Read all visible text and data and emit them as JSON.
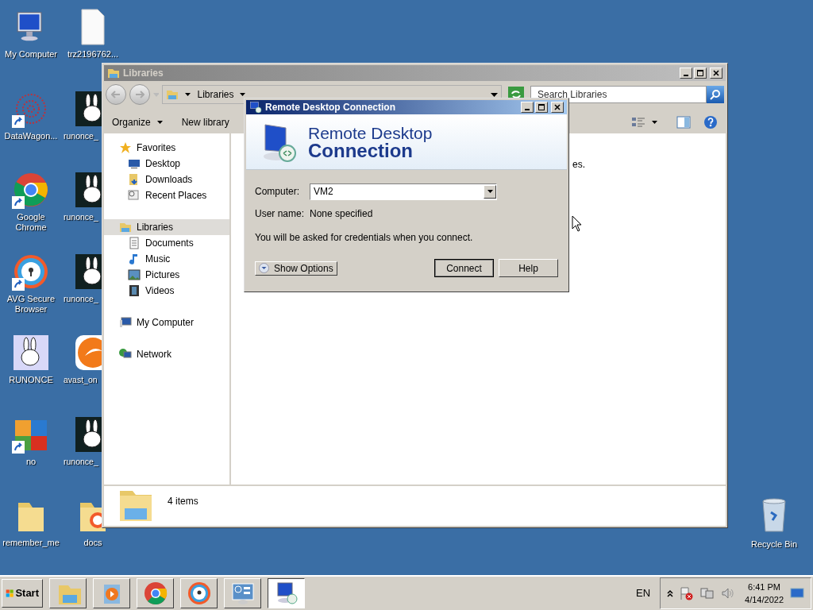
{
  "desktop_icons": [
    {
      "label": "My Computer",
      "kind": "computer",
      "shortcut": false
    },
    {
      "label": "DataWagon...",
      "kind": "network-graphic",
      "shortcut": true
    },
    {
      "label": "Google Chrome",
      "kind": "chrome",
      "shortcut": true
    },
    {
      "label": "AVG Secure Browser",
      "kind": "avg-browser",
      "shortcut": true
    },
    {
      "label": "RUNONCE",
      "kind": "rabbit",
      "shortcut": false
    },
    {
      "label": "no",
      "kind": "avg",
      "shortcut": true
    },
    {
      "label": "remember_me",
      "kind": "folder",
      "shortcut": false
    },
    {
      "label": "trz2196762...",
      "kind": "file",
      "shortcut": false
    },
    {
      "label": "runonce_",
      "kind": "rabbit-thumb",
      "shortcut": false
    },
    {
      "label": "runonce_",
      "kind": "rabbit-thumb",
      "shortcut": false
    },
    {
      "label": "runonce_",
      "kind": "rabbit-thumb",
      "shortcut": false
    },
    {
      "label": "avast_on",
      "kind": "avast",
      "shortcut": false
    },
    {
      "label": "runonce_",
      "kind": "rabbit-thumb",
      "shortcut": false
    },
    {
      "label": "docs",
      "kind": "folder-app",
      "shortcut": false
    }
  ],
  "recycle_bin": {
    "label": "Recycle Bin"
  },
  "libraries_window": {
    "title": "Libraries",
    "active": false,
    "address": "Libraries",
    "search": {
      "placeholder": "Search Libraries"
    },
    "commands": [
      {
        "label": "Organize",
        "menu": true
      },
      {
        "label": "New library",
        "menu": false
      }
    ],
    "nav": [
      {
        "label": "Favorites",
        "kind": "star",
        "selected": false,
        "children": [
          {
            "label": "Desktop",
            "kind": "desktop",
            "selected": false
          },
          {
            "label": "Downloads",
            "kind": "downloads",
            "selected": false
          },
          {
            "label": "Recent Places",
            "kind": "recent",
            "selected": false
          }
        ]
      },
      {
        "label": "Libraries",
        "kind": "library",
        "selected": true,
        "children": [
          {
            "label": "Documents",
            "kind": "documents",
            "selected": false
          },
          {
            "label": "Music",
            "kind": "music",
            "selected": false
          },
          {
            "label": "Pictures",
            "kind": "pictures",
            "selected": false
          },
          {
            "label": "Videos",
            "kind": "videos",
            "selected": false
          }
        ]
      },
      {
        "label": "My Computer",
        "kind": "computer",
        "selected": false
      },
      {
        "label": "Network",
        "kind": "network",
        "selected": false
      }
    ],
    "content_text": "es.",
    "status": "4 items"
  },
  "rdc_dialog": {
    "title": "Remote Desktop Connection",
    "active": true,
    "heading": "Remote Desktop",
    "heading_bold": "Connection",
    "computer": {
      "label": "Computer:",
      "value": "VM2"
    },
    "user": {
      "label": "User name:",
      "value": "None specified"
    },
    "note": "You will be asked for credentials when you connect.",
    "show_options": "Show Options",
    "buttons": [
      {
        "label": "Connect",
        "default": true
      },
      {
        "label": "Help",
        "default": false
      }
    ]
  },
  "taskbar": {
    "start": "Start",
    "apps": [
      {
        "kind": "explorer",
        "active": false
      },
      {
        "kind": "media",
        "active": false
      },
      {
        "kind": "chrome",
        "active": false
      },
      {
        "kind": "avg-browser",
        "active": false
      },
      {
        "kind": "control-panel",
        "active": false
      },
      {
        "kind": "rdc",
        "active": true
      }
    ],
    "language": "EN",
    "time": "6:41 PM",
    "date": "4/14/2022"
  }
}
